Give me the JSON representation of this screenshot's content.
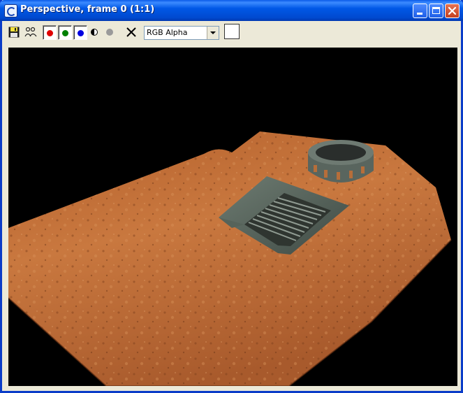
{
  "window": {
    "title": "Perspective, frame 0 (1:1)",
    "controls": [
      "minimize",
      "maximize",
      "close"
    ],
    "accent": "#0A5BE8",
    "close_color": "#D9542F"
  },
  "toolbar": {
    "items": [
      {
        "name": "save-icon",
        "icon": "floppy-disk"
      },
      {
        "name": "clone-icon",
        "icon": "clone-window"
      },
      {
        "name": "red-channel-toggle",
        "icon": "red-dot",
        "color": "#E00000"
      },
      {
        "name": "green-channel-toggle",
        "icon": "green-dot",
        "color": "#008000"
      },
      {
        "name": "blue-channel-toggle",
        "icon": "blue-dot",
        "color": "#0000E0"
      },
      {
        "name": "monochrome-toggle",
        "icon": "half-circle"
      },
      {
        "name": "alpha-channel-toggle",
        "icon": "gray-dot"
      },
      {
        "name": "clear-button",
        "icon": "x-mark"
      }
    ],
    "channel_select": {
      "value": "RGB Alpha"
    },
    "color_swatch": {
      "color": "#FFFFFF"
    }
  },
  "render": {
    "background": "#000000",
    "scene": [
      "terrain",
      "ramp-stairs",
      "circular-tower"
    ]
  }
}
